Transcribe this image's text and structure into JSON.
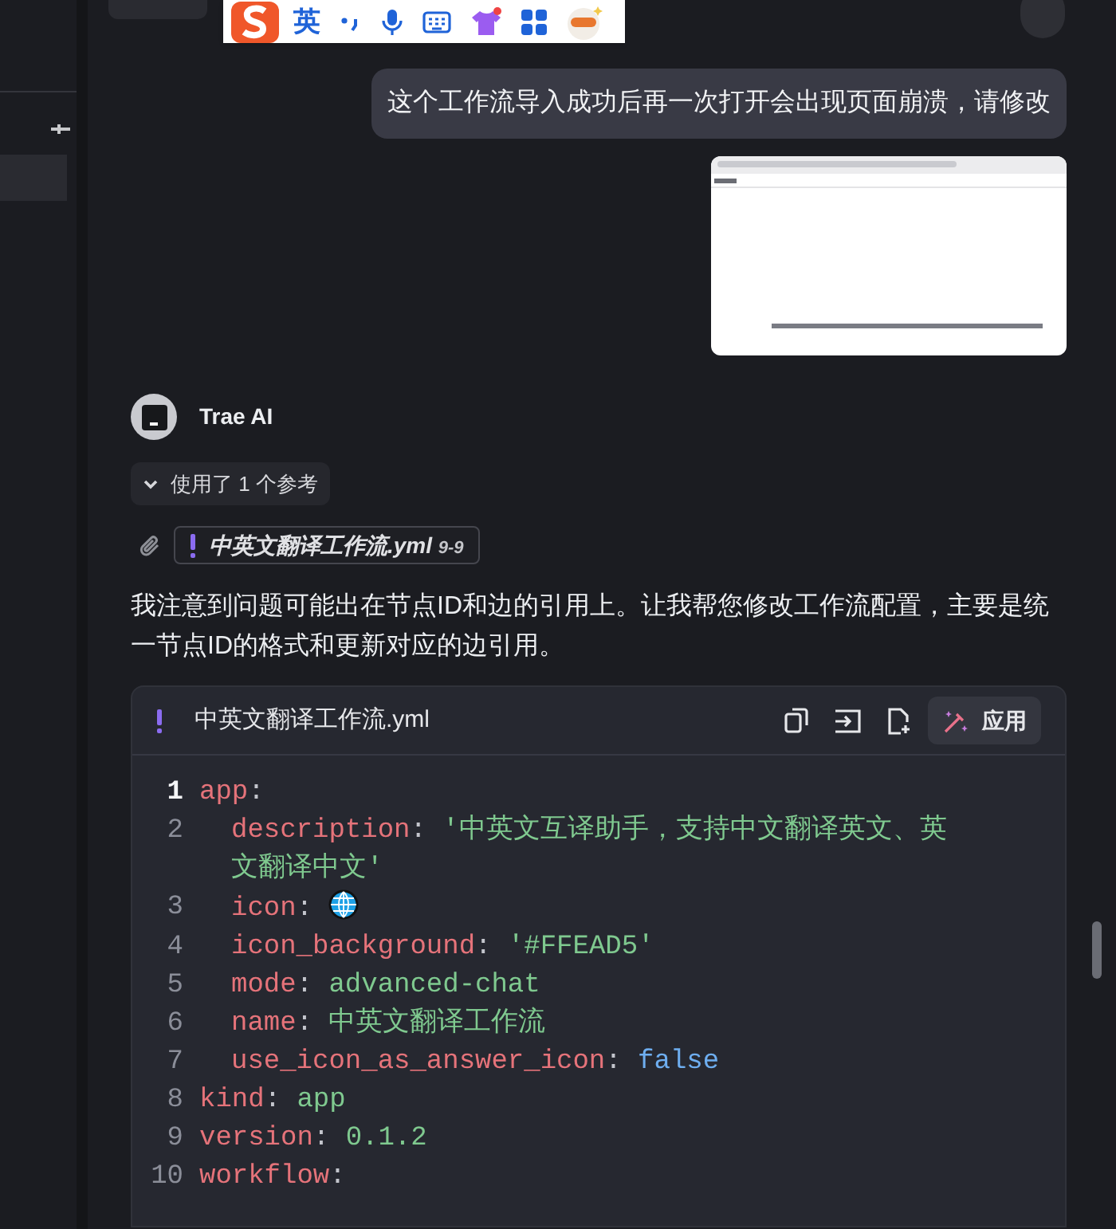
{
  "ime_toolbar": {
    "mode_label": "英"
  },
  "user_message": {
    "text": "这个工作流导入成功后再一次打开会出现页面崩溃，请修改"
  },
  "assistant": {
    "name": "Trae AI"
  },
  "references_toggle": {
    "label": "使用了 1 个参考",
    "expanded": false
  },
  "reference_chip": {
    "filename": "中英文翻译工作流.yml",
    "range": "9-9"
  },
  "message": "我注意到问题可能出在节点ID和边的引用上。让我帮您修改工作流配置，主要是统一节点ID的格式和更新对应的边引用。",
  "code_block": {
    "filename": "中英文翻译工作流.yml",
    "apply_label": "应用",
    "lines": [
      {
        "number": "1",
        "current": true,
        "tokens": [
          {
            "kind": "key",
            "text": "app"
          },
          {
            "kind": "punct",
            "text": ":"
          }
        ],
        "children": [
          {
            "number": "2",
            "current": false,
            "tokens": [
              {
                "kind": "key",
                "text": "description"
              },
              {
                "kind": "punct",
                "text": ": "
              },
              {
                "kind": "string",
                "text": "'中英文互译助手，支持中文翻译英文、英文翻译中文'"
              }
            ]
          },
          {
            "number": "3",
            "current": false,
            "tokens": [
              {
                "kind": "key",
                "text": "icon"
              },
              {
                "kind": "punct",
                "text": ": "
              },
              {
                "kind": "globe"
              }
            ]
          },
          {
            "number": "4",
            "current": false,
            "tokens": [
              {
                "kind": "key",
                "text": "icon_background"
              },
              {
                "kind": "punct",
                "text": ": "
              },
              {
                "kind": "string",
                "text": "'#FFEAD5'"
              }
            ]
          },
          {
            "number": "5",
            "current": false,
            "tokens": [
              {
                "kind": "key",
                "text": "mode"
              },
              {
                "kind": "punct",
                "text": ": "
              },
              {
                "kind": "string",
                "text": "advanced-chat"
              }
            ]
          },
          {
            "number": "6",
            "current": false,
            "tokens": [
              {
                "kind": "key",
                "text": "name"
              },
              {
                "kind": "punct",
                "text": ": "
              },
              {
                "kind": "string",
                "text": "中英文翻译工作流"
              }
            ]
          },
          {
            "number": "7",
            "current": false,
            "tokens": [
              {
                "kind": "key",
                "text": "use_icon_as_answer_icon"
              },
              {
                "kind": "punct",
                "text": ": "
              },
              {
                "kind": "bool",
                "text": "false"
              }
            ]
          }
        ]
      },
      {
        "number": "8",
        "current": false,
        "tokens": [
          {
            "kind": "key",
            "text": "kind"
          },
          {
            "kind": "punct",
            "text": ": "
          },
          {
            "kind": "string",
            "text": "app"
          }
        ]
      },
      {
        "number": "9",
        "current": false,
        "tokens": [
          {
            "kind": "key",
            "text": "version"
          },
          {
            "kind": "punct",
            "text": ": "
          },
          {
            "kind": "string",
            "text": "0.1.2"
          }
        ]
      },
      {
        "number": "10",
        "current": false,
        "tokens": [
          {
            "kind": "key",
            "text": "workflow"
          },
          {
            "kind": "punct",
            "text": ":"
          }
        ]
      }
    ]
  }
}
